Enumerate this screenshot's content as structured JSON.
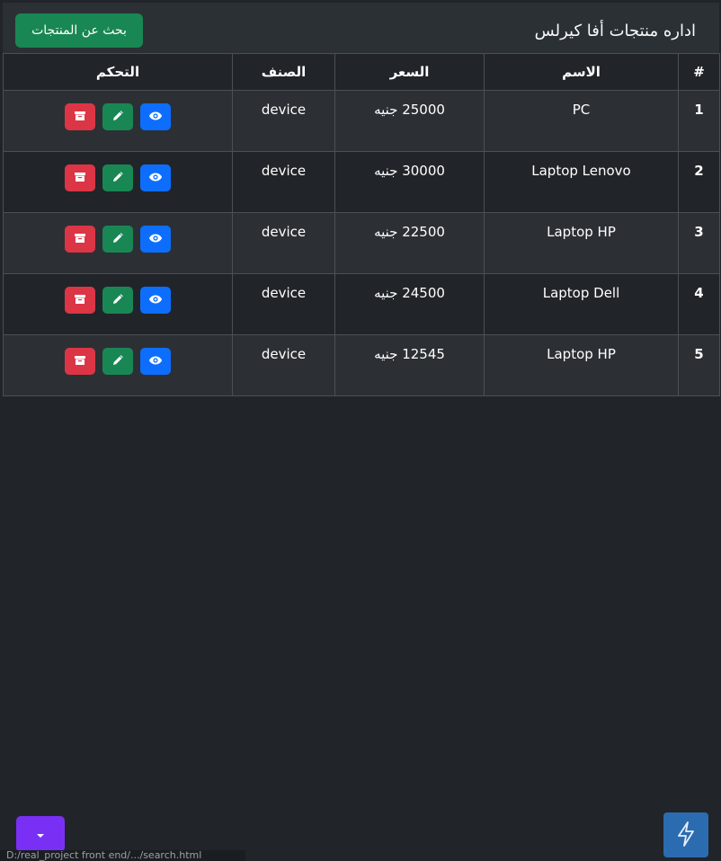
{
  "header": {
    "title": "اداره منتجات أفا كيرلس",
    "search_button": "بحث عن المنتجات"
  },
  "table": {
    "headers": {
      "num": "#",
      "name": "الاسم",
      "price": "السعر",
      "category": "الصنف",
      "controls": "التحكم"
    },
    "currency": "جنيه",
    "rows": [
      {
        "num": "1",
        "name": "PC",
        "price": "25000",
        "category": "device"
      },
      {
        "num": "2",
        "name": "Laptop Lenovo",
        "price": "30000",
        "category": "device"
      },
      {
        "num": "3",
        "name": "Laptop HP",
        "price": "22500",
        "category": "device"
      },
      {
        "num": "4",
        "name": "Laptop Dell",
        "price": "24500",
        "category": "device"
      },
      {
        "num": "5",
        "name": "Laptop HP",
        "price": "12545",
        "category": "device"
      }
    ]
  },
  "icons": {
    "view": "eye-icon",
    "edit": "pencil-icon",
    "delete": "archive-icon",
    "dropdown": "caret-down-icon",
    "bolt": "lightning-icon"
  },
  "colors": {
    "view": "#0d6efd",
    "edit": "#198754",
    "delete": "#dc3545",
    "dropdown": "#7a2ff5",
    "bolt": "#2b6cb0"
  },
  "status_bar": {
    "url": "D:/real_project front end/.../search.html"
  }
}
